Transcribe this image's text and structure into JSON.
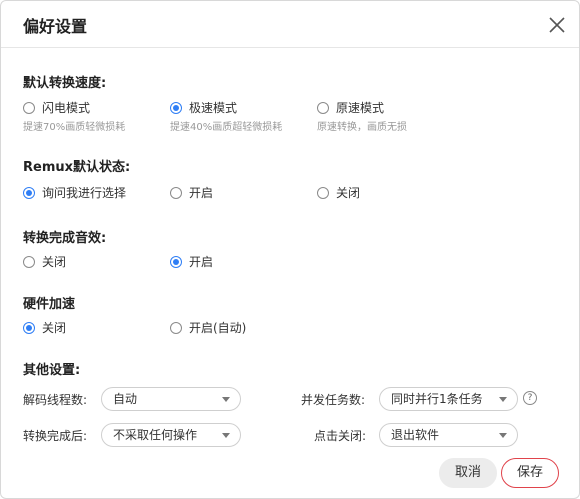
{
  "dialog": {
    "title": "偏好设置"
  },
  "speed": {
    "title": "默认转换速度:",
    "options": [
      {
        "label": "闪电模式",
        "hint": "提速70%画质轻微损耗",
        "selected": false
      },
      {
        "label": "极速模式",
        "hint": "提速40%画质超轻微损耗",
        "selected": true
      },
      {
        "label": "原速模式",
        "hint": "原速转换，画质无损",
        "selected": false
      }
    ]
  },
  "remux": {
    "title": "Remux默认状态:",
    "options": [
      {
        "label": "询问我进行选择",
        "selected": true
      },
      {
        "label": "开启",
        "selected": false
      },
      {
        "label": "关闭",
        "selected": false
      }
    ]
  },
  "sound": {
    "title": "转换完成音效:",
    "options": [
      {
        "label": "关闭",
        "selected": false
      },
      {
        "label": "开启",
        "selected": true
      }
    ]
  },
  "hwaccel": {
    "title": "硬件加速",
    "options": [
      {
        "label": "关闭",
        "selected": true
      },
      {
        "label": "开启(自动)",
        "selected": false
      }
    ]
  },
  "other": {
    "title": "其他设置:",
    "decode_threads": {
      "label": "解码线程数:",
      "value": "自动"
    },
    "concurrent_tasks": {
      "label": "并发任务数:",
      "value": "同时并行1条任务"
    },
    "after_convert": {
      "label": "转换完成后:",
      "value": "不采取任何操作"
    },
    "on_close": {
      "label": "点击关闭:",
      "value": "退出软件"
    },
    "help_glyph": "?"
  },
  "buttons": {
    "cancel": "取消",
    "save": "保存"
  },
  "colors": {
    "accent": "#2f7ef5",
    "save_border": "#e0434b"
  }
}
